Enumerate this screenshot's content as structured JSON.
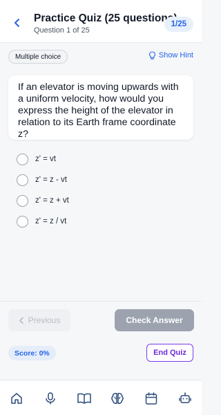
{
  "header": {
    "title": "Practice Quiz (25 questions)",
    "subtitle": "Question 1 of 25",
    "progress": "1/25",
    "back_icon": "chevron-left-icon"
  },
  "question": {
    "type": "Multiple choice",
    "hint_label": "Show Hint",
    "hint_icon": "lightbulb-icon",
    "text": "If an elevator is moving upwards with a uniform velocity, how would you express the height of the elevator in relation to its Earth frame coordinate z?",
    "options": [
      {
        "label": "z' = vt"
      },
      {
        "label": "z' = z - vt"
      },
      {
        "label": "z' = z + vt"
      },
      {
        "label": "z' = z / vt"
      }
    ]
  },
  "actions": {
    "previous_label": "Previous",
    "check_label": "Check Answer",
    "score_label": "Score: 0%",
    "end_label": "End Quiz"
  },
  "tabbar": {
    "items": [
      {
        "icon": "home-icon"
      },
      {
        "icon": "microphone-icon"
      },
      {
        "icon": "book-icon"
      },
      {
        "icon": "brain-icon"
      },
      {
        "icon": "calendar-icon"
      },
      {
        "icon": "robot-icon"
      }
    ]
  },
  "colors": {
    "accent": "#2563eb",
    "purple": "#7c3aed",
    "disabled": "#9ca3af",
    "background": "#f6f7f9"
  }
}
